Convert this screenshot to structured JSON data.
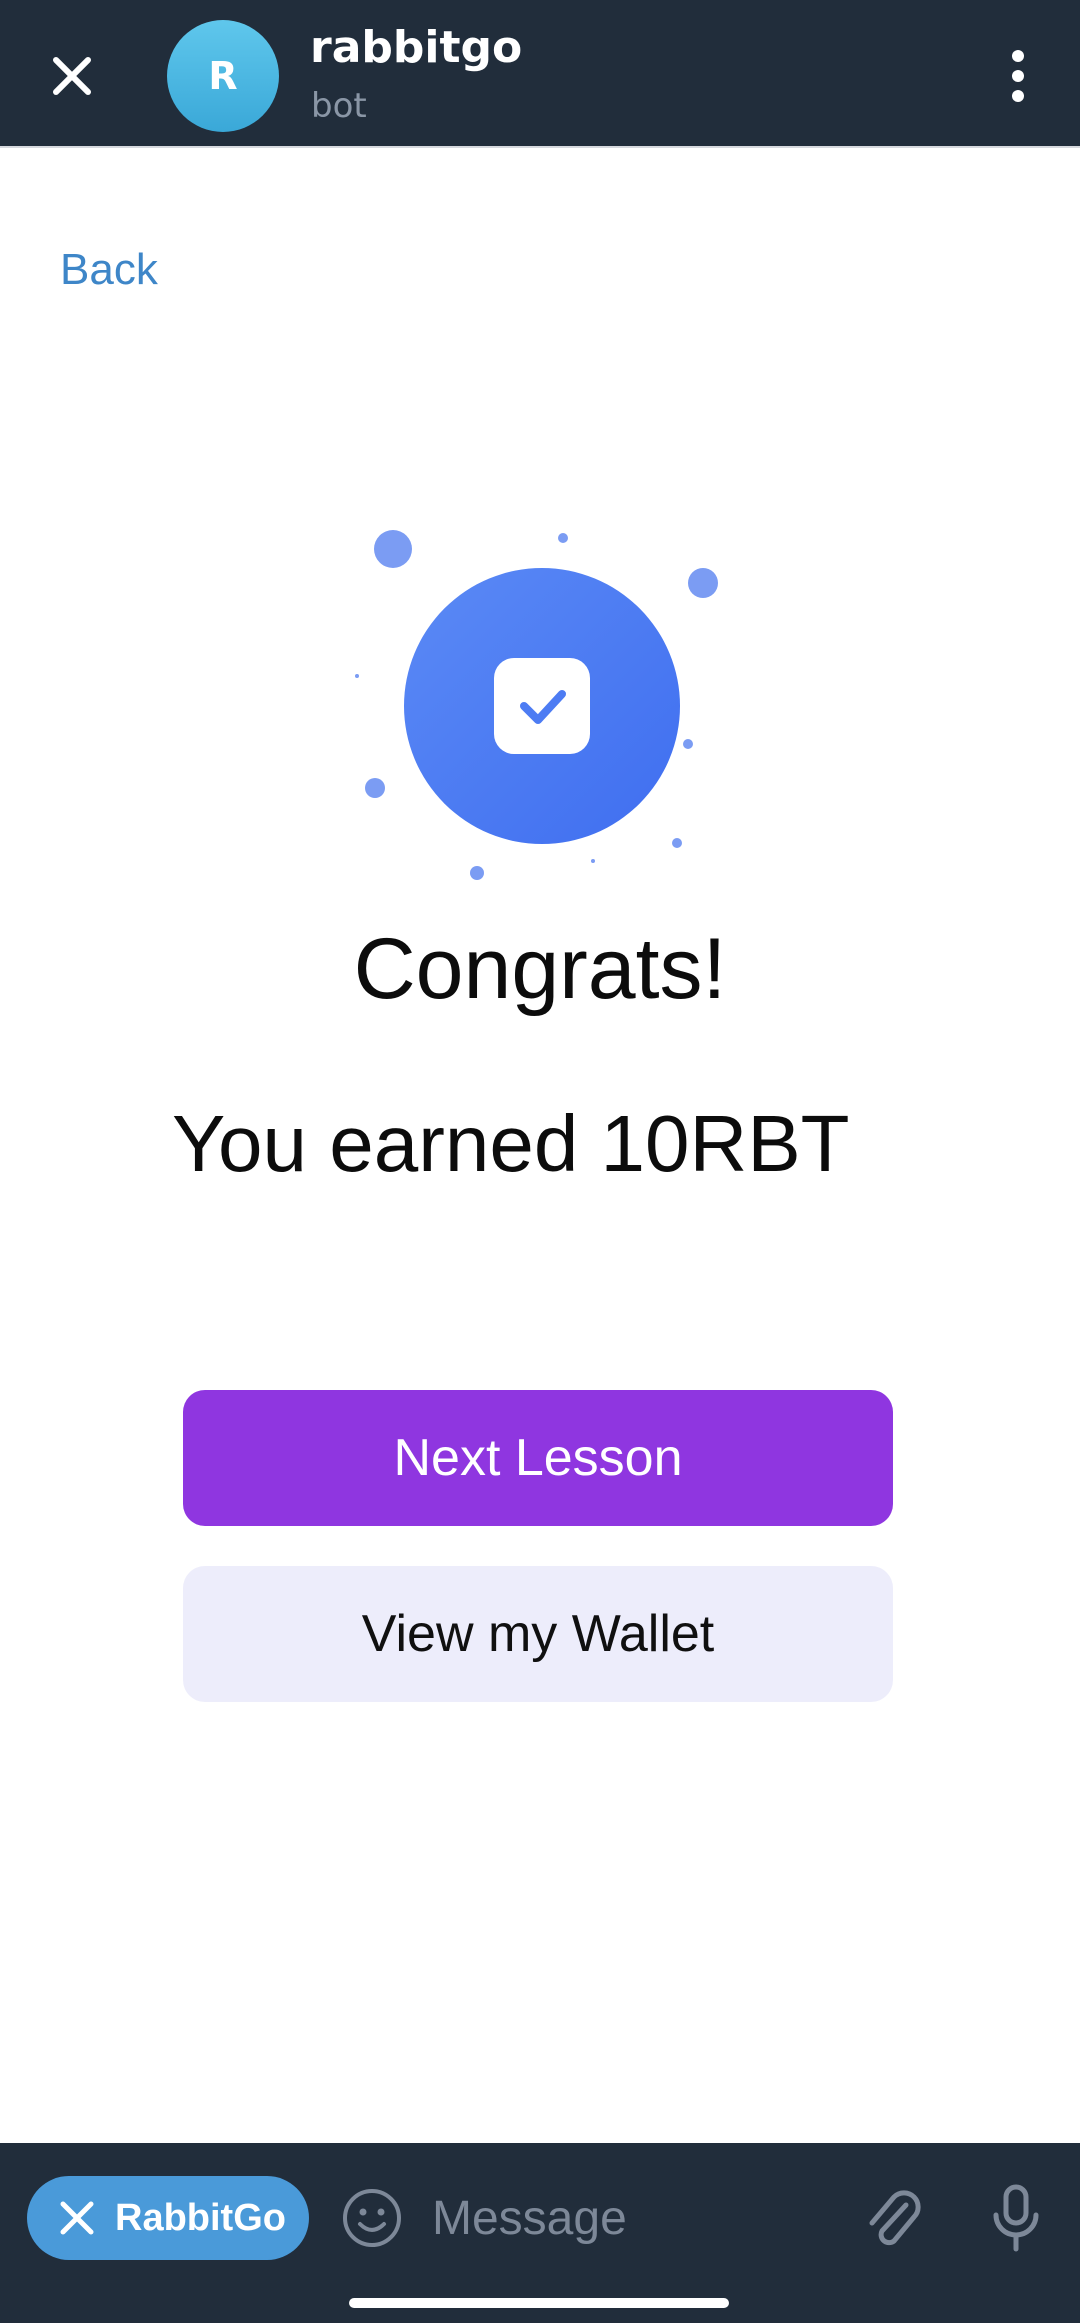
{
  "header": {
    "avatar_letter": "R",
    "title": "rabbitgo",
    "subtitle": "bot",
    "close_icon": "close-icon",
    "menu_icon": "more-vertical-icon"
  },
  "main": {
    "back_label": "Back",
    "congrats_text": "Congrats!",
    "earned_text": "You earned 10RBT",
    "next_lesson_label": "Next Lesson",
    "view_wallet_label": "View my Wallet"
  },
  "bottom": {
    "chip_label": "RabbitGo",
    "message_placeholder": "Message",
    "icons": [
      "close-icon",
      "emoji-icon",
      "attach-icon",
      "microphone-icon"
    ]
  },
  "colors": {
    "header_bg": "#212d3b",
    "accent_purple": "#8f36e0",
    "secondary_button_bg": "#ededfb",
    "link_blue": "#3e86c8",
    "illustration_blue": "#4d7cf3"
  }
}
